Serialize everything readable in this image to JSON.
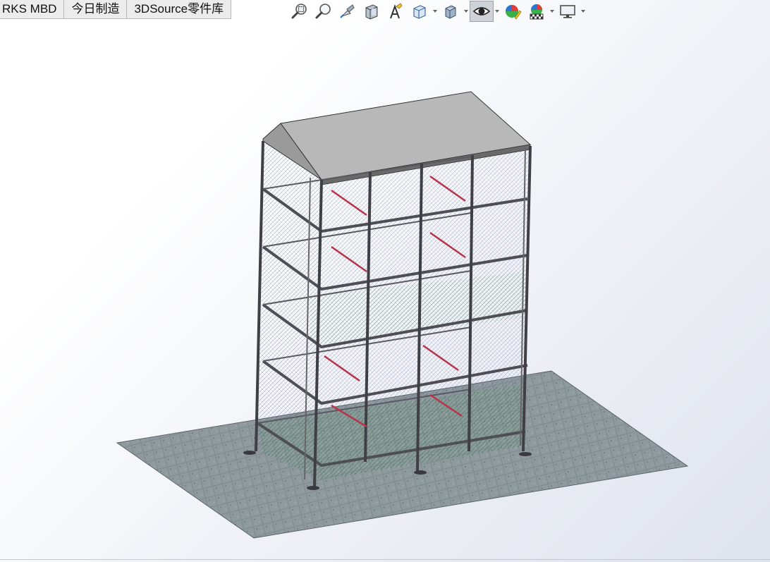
{
  "tabs": [
    {
      "label": "RKS MBD"
    },
    {
      "label": "今日制造"
    },
    {
      "label": "3DSource零件库"
    }
  ],
  "toolbar": {
    "icons": [
      "zoom-to-fit-icon",
      "zoom-to-area-icon",
      "previous-view-icon",
      "section-view-icon",
      "dynamic-annotation-views-icon",
      "view-orientation-icon",
      "display-style-icon",
      "hide-show-items-icon",
      "edit-appearance-icon",
      "apply-scene-icon",
      "view-settings-icon"
    ]
  },
  "model": {
    "description_hidden": "",
    "floor_color": "#7d8a8e",
    "roof_color": "#a9a9a9",
    "frame_color": "#5a5a5e"
  }
}
